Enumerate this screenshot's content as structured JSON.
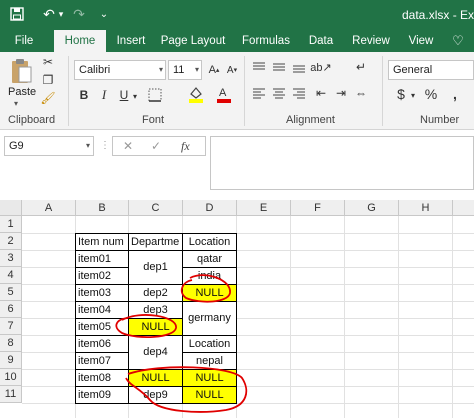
{
  "window": {
    "title": "data.xlsx - Excel",
    "quick_access": {
      "save_icon": "save-icon",
      "undo_icon": "undo-icon",
      "redo_icon": "redo-icon"
    }
  },
  "ribbon": {
    "tabs": [
      "File",
      "Home",
      "Insert",
      "Page Layout",
      "Formulas",
      "Data",
      "Review",
      "View"
    ],
    "active_tab": "Home",
    "clipboard": {
      "paste_label": "Paste",
      "group_label": "Clipboard"
    },
    "font": {
      "font_name": "Calibri",
      "font_size": "11",
      "group_label": "Font",
      "bold": "B",
      "italic": "I",
      "underline": "U"
    },
    "alignment": {
      "group_label": "Alignment"
    },
    "number": {
      "format": "General",
      "group_label": "Number",
      "currency": "$",
      "percent": "%"
    }
  },
  "formula_bar": {
    "name_box": "G9",
    "cancel": "✕",
    "enter": "✓",
    "fx": "fx",
    "value": ""
  },
  "sheet": {
    "columns": [
      "A",
      "B",
      "C",
      "D",
      "E",
      "F",
      "G",
      "H"
    ],
    "rows": [
      "1",
      "2",
      "3",
      "4",
      "5",
      "6",
      "7",
      "8",
      "9",
      "10",
      "11"
    ],
    "header": {
      "item": "Item num",
      "department": "Departme",
      "location": "Location"
    },
    "items": [
      "item01",
      "item02",
      "item03",
      "item04",
      "item05",
      "item06",
      "item07",
      "item08",
      "item09"
    ],
    "departments": {
      "dep1": "dep1",
      "dep2": "dep2",
      "dep3": "dep3",
      "c7": "NULL",
      "dep4": "dep4",
      "c10": "NULL",
      "dep9": "dep9"
    },
    "locations": {
      "d3": "qatar",
      "d4": "india",
      "d5": "NULL",
      "germany": "germany",
      "d8": "Location",
      "d9": "nepal",
      "d10": "NULL",
      "d11": "NULL"
    },
    "highlight_color": "#ffff00",
    "annotation_color": "#e00000"
  }
}
